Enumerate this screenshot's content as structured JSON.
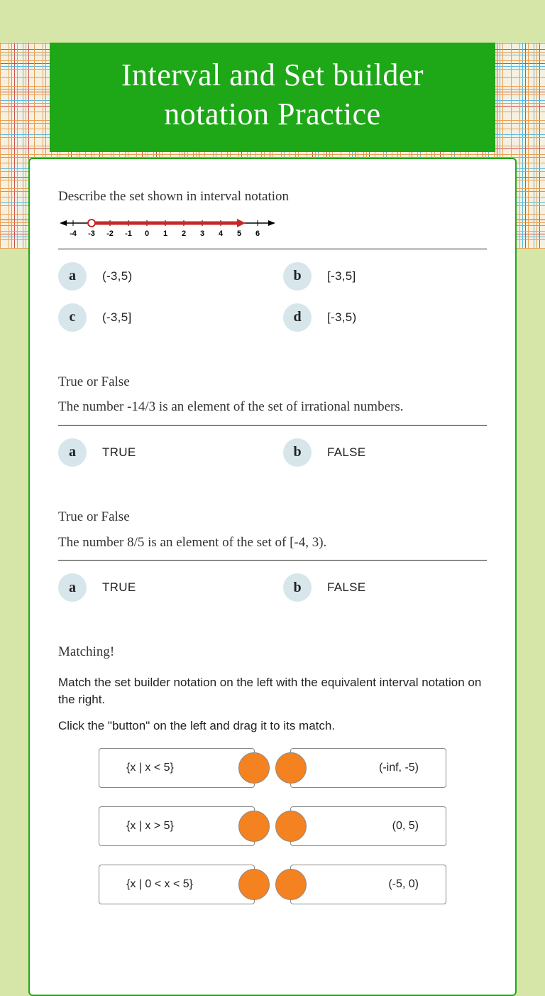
{
  "title": "Interval and Set builder notation Practice",
  "q1": {
    "prompt": "Describe the set shown in interval notation",
    "ticks": [
      "-4",
      "-3",
      "-2",
      "-1",
      "0",
      "1",
      "2",
      "3",
      "4",
      "5",
      "6"
    ],
    "options": {
      "a": "(-3,5)",
      "b": "[-3,5]",
      "c": "(-3,5]",
      "d": "[-3,5)"
    }
  },
  "q2": {
    "lead": "True or False",
    "prompt": "The number -14/3 is an element of the set of irrational numbers.",
    "options": {
      "a": "TRUE",
      "b": "FALSE"
    }
  },
  "q3": {
    "lead": "True or False",
    "prompt": "The number 8/5 is an element of the set of [-4, 3).",
    "options": {
      "a": "TRUE",
      "b": "FALSE"
    }
  },
  "q4": {
    "lead": "Matching!",
    "instr1": "Match the set builder notation on the left with the equivalent interval notation on the right.",
    "instr2": "Click the \"button\" on the left and drag it to its match.",
    "pairs": [
      {
        "left": "{x | x < 5}",
        "right": "(-inf, -5)"
      },
      {
        "left": "{x | x > 5}",
        "right": "(0, 5)"
      },
      {
        "left": "{x | 0 < x < 5}",
        "right": "(-5, 0)"
      }
    ]
  }
}
